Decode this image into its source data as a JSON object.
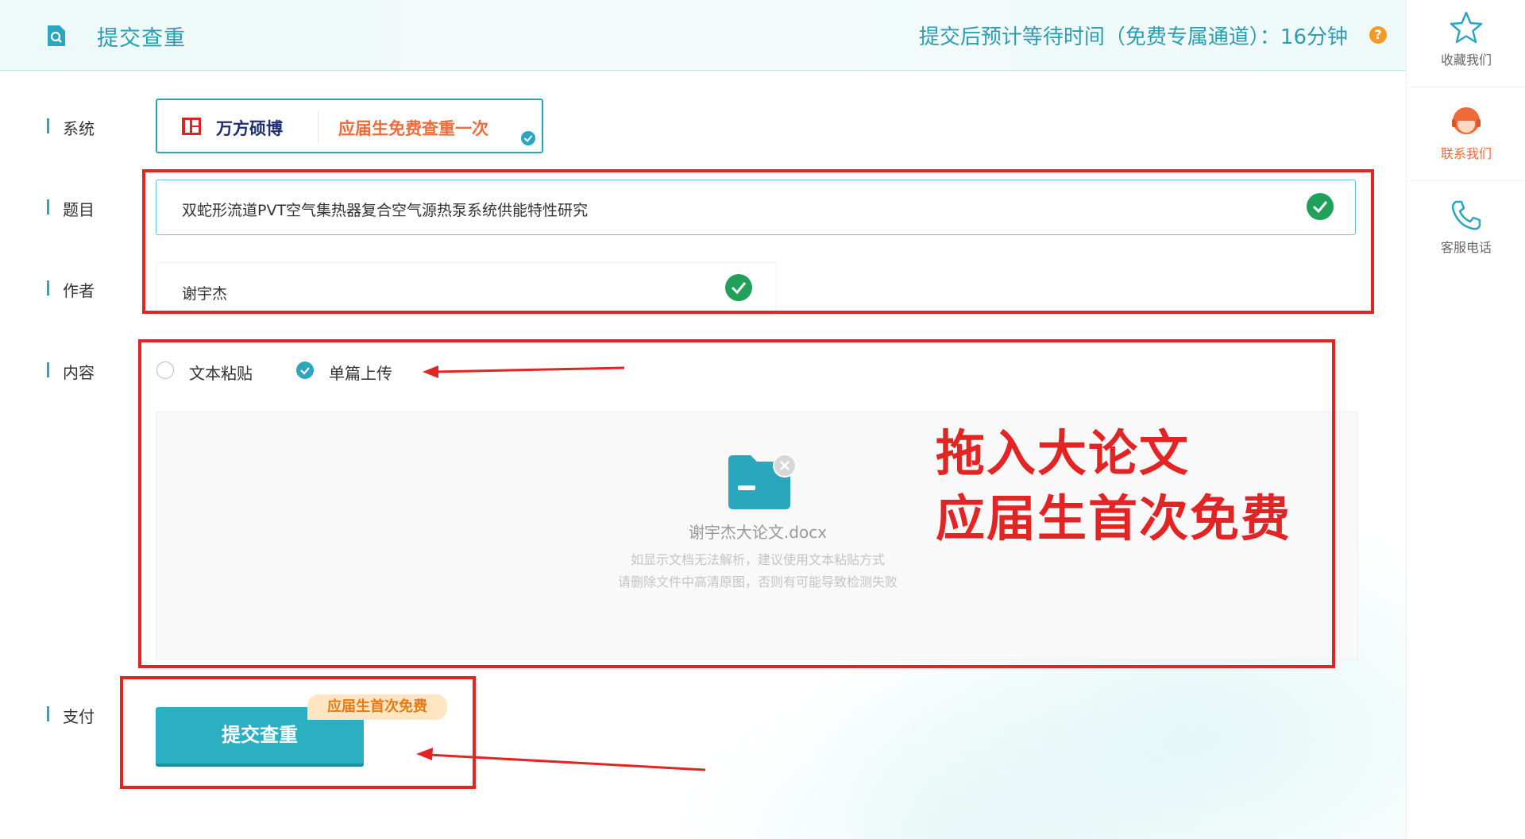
{
  "header": {
    "title": "提交查重",
    "wait_text": "提交后预计等待时间（免费专属通道）：16分钟",
    "help": "?"
  },
  "sidebar": {
    "items": [
      {
        "label": "收藏我们",
        "icon": "star-icon"
      },
      {
        "label": "联系我们",
        "icon": "agent-icon"
      },
      {
        "label": "客服电话",
        "icon": "phone-icon"
      }
    ]
  },
  "form": {
    "system_label": "系统",
    "system_brand": "万方硕博",
    "system_promo": "应届生免费查重一次",
    "title_label": "题目",
    "title_value": "双蛇形流道PVT空气集热器复合空气源热泵系统供能特性研究",
    "author_label": "作者",
    "author_value": "谢宇杰",
    "content_label": "内容",
    "radio_paste": "文本粘贴",
    "radio_upload": "单篇上传",
    "upload_filename": "谢宇杰大论文.docx",
    "upload_hint1": "如显示文档无法解析，建议使用文本粘贴方式",
    "upload_hint2": "请删除文件中高清原图，否则有可能导致检测失败",
    "pay_label": "支付",
    "submit_label": "提交查重",
    "badge": "应届生首次免费"
  },
  "annotation": {
    "line1": "拖入大论文",
    "line2": "应届生首次免费"
  },
  "colors": {
    "accent": "#2aa6bd",
    "red_annotation": "#e32424",
    "check_green": "#21a05a",
    "promo_orange": "#f06a3a"
  }
}
